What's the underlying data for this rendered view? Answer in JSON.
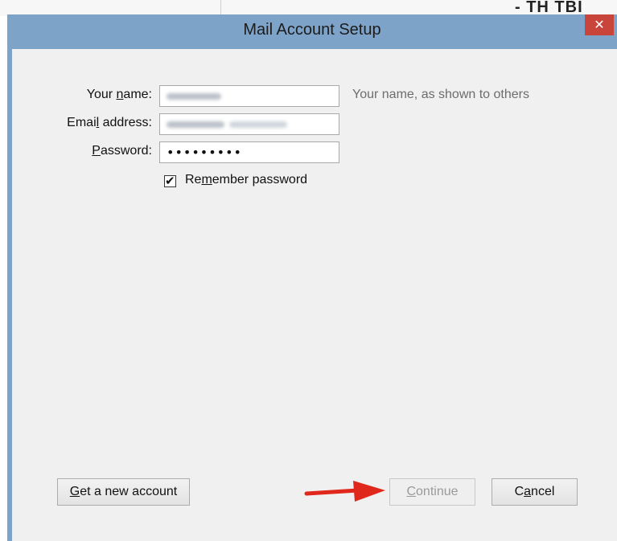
{
  "window": {
    "title": "Mail Account Setup",
    "close_glyph": "✕"
  },
  "background": {
    "partial_text": "- TH  TBI"
  },
  "form": {
    "name": {
      "label_pre": "Your ",
      "label_ul": "n",
      "label_post": "ame:",
      "hint": "Your name, as shown to others"
    },
    "email": {
      "label_pre": "Emai",
      "label_ul": "l",
      "label_post": " address:"
    },
    "password": {
      "label_pre": "",
      "label_ul": "P",
      "label_post": "assword:",
      "value": "•••••••••"
    },
    "remember": {
      "label_pre": "Re",
      "label_ul": "m",
      "label_post": "ember password",
      "checked": true,
      "check_glyph": "✔"
    }
  },
  "buttons": {
    "get_account": {
      "label_ul": "G",
      "label_post": "et a new account"
    },
    "continue": {
      "label_ul": "C",
      "label_post": "ontinue",
      "disabled": true
    },
    "cancel": {
      "label_pre": "C",
      "label_ul": "a",
      "label_post": "ncel"
    }
  },
  "colors": {
    "accent_arrow": "#e0271b",
    "titlebar": "#7ea3c9",
    "close_button": "#c9443b"
  },
  "icons": {
    "close": "close-icon",
    "arrow": "red-arrow-annotation"
  }
}
